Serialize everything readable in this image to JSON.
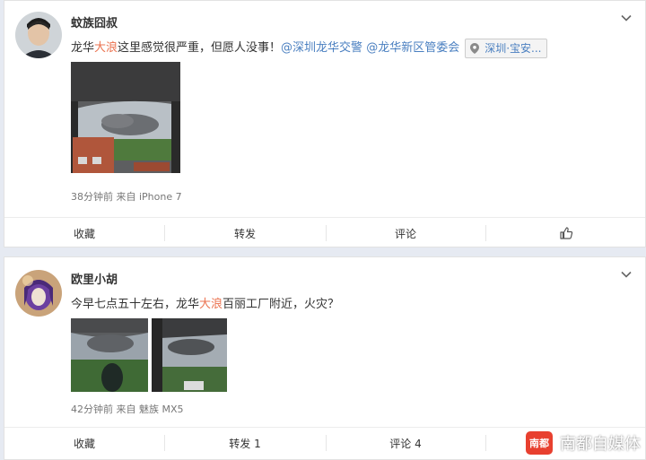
{
  "posts": [
    {
      "username": "蚊族囧叔",
      "avatar_icon": "user-avatar",
      "text_before": "龙华",
      "text_highlight": "大浪",
      "text_after": "这里感觉很严重，但愿人没事！",
      "mentions": [
        "@深圳龙华交警",
        "@龙华新区管委会"
      ],
      "location": "深圳·宝安...",
      "meta": "38分钟前 来自 iPhone 7",
      "actions": {
        "favorite": "收藏",
        "forward": "转发",
        "comment": "评论",
        "like_icon": "thumbs-up-icon"
      }
    },
    {
      "username": "欧里小胡",
      "avatar_icon": "user-avatar",
      "text_before": "今早七点五十左右，龙华",
      "text_highlight": "大浪",
      "text_after": "百丽工厂附近，火灾？",
      "meta": "42分钟前 来自 魅族 MX5",
      "actions": {
        "favorite": "收藏",
        "forward": "转发 1",
        "comment": "评论 4"
      }
    }
  ],
  "colors": {
    "highlight": "#eb7350",
    "link": "#4a7fc0",
    "background": "#e6eaf2",
    "watermark_badge": "#e8402f"
  },
  "watermark": {
    "badge": "南都",
    "text": "南都自媒体"
  }
}
